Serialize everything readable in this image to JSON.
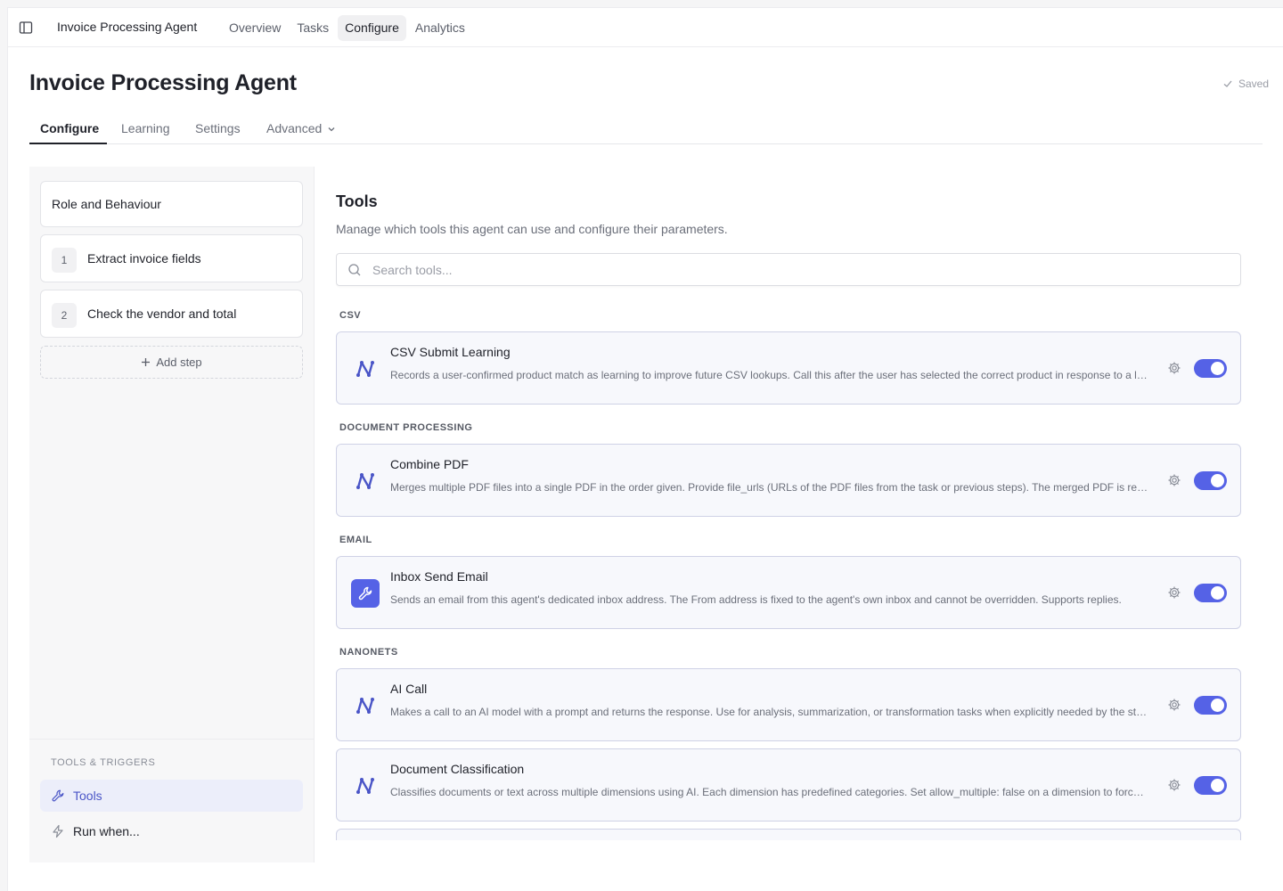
{
  "topbar": {
    "app_title": "Invoice Processing Agent",
    "nav": [
      {
        "label": "Overview",
        "active": false
      },
      {
        "label": "Tasks",
        "active": false
      },
      {
        "label": "Configure",
        "active": true
      },
      {
        "label": "Analytics",
        "active": false
      }
    ]
  },
  "page": {
    "title": "Invoice Processing Agent",
    "save_status": "Saved"
  },
  "tabs": [
    {
      "label": "Configure",
      "active": true
    },
    {
      "label": "Learning",
      "active": false
    },
    {
      "label": "Settings",
      "active": false
    },
    {
      "label": "Advanced",
      "active": false,
      "has_dropdown": true
    }
  ],
  "steps_panel": {
    "role_card": "Role and Behaviour",
    "steps": [
      {
        "number": "1",
        "label": "Extract invoice fields"
      },
      {
        "number": "2",
        "label": "Check the vendor and total"
      }
    ],
    "add_step_label": "Add step",
    "tools_triggers": {
      "heading": "TOOLS & TRIGGERS",
      "items": [
        {
          "label": "Tools",
          "icon": "wrench-icon",
          "active": true
        },
        {
          "label": "Run when...",
          "icon": "lightning-icon",
          "active": false
        }
      ]
    }
  },
  "tools": {
    "title": "Tools",
    "subtitle": "Manage which tools this agent can use and configure their parameters.",
    "search_placeholder": "Search tools...",
    "groups": [
      {
        "label": "CSV",
        "tools": [
          {
            "name": "CSV Submit Learning",
            "description": "Records a user-confirmed product match as learning to improve future CSV lookups. Call this after the user has selected the correct product in response to a lookup.",
            "icon": "nanonets-logo-icon",
            "enabled": true
          }
        ]
      },
      {
        "label": "DOCUMENT PROCESSING",
        "tools": [
          {
            "name": "Combine PDF",
            "description": "Merges multiple PDF files into a single PDF in the order given. Provide file_urls (URLs of the PDF files from the task or previous steps). The merged PDF is returned.",
            "icon": "nanonets-logo-icon",
            "enabled": true
          }
        ]
      },
      {
        "label": "EMAIL",
        "tools": [
          {
            "name": "Inbox Send Email",
            "description": "Sends an email from this agent's dedicated inbox address. The From address is fixed to the agent's own inbox and cannot be overridden. Supports replies.",
            "icon": "wrench-icon",
            "enabled": true
          }
        ]
      },
      {
        "label": "NANONETS",
        "tools": [
          {
            "name": "AI Call",
            "description": "Makes a call to an AI model with a prompt and returns the response. Use for analysis, summarization, or transformation tasks when explicitly needed by the step.",
            "icon": "nanonets-logo-icon",
            "enabled": true
          },
          {
            "name": "Document Classification",
            "description": "Classifies documents or text across multiple dimensions using AI. Each dimension has predefined categories. Set allow_multiple: false on a dimension to force a single category.",
            "icon": "nanonets-logo-icon",
            "enabled": true
          }
        ]
      }
    ]
  },
  "colors": {
    "accent": "#5562e6",
    "card_border": "#cfd2e6",
    "card_bg": "#f7f8fc"
  }
}
